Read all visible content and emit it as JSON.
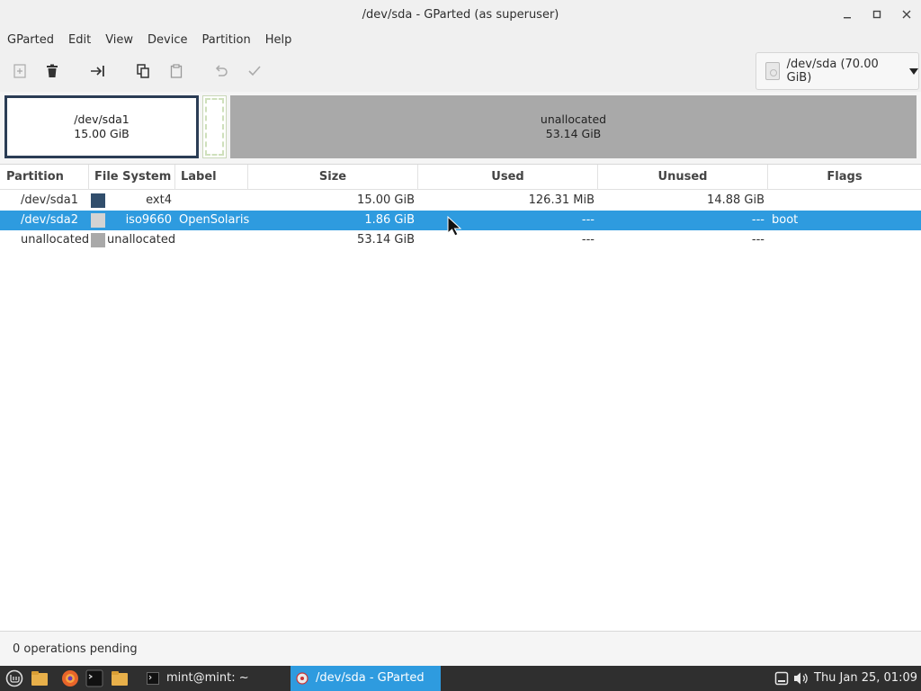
{
  "window": {
    "title": "/dev/sda - GParted (as superuser)"
  },
  "menu": [
    "GParted",
    "Edit",
    "View",
    "Device",
    "Partition",
    "Help"
  ],
  "toolbar": {
    "device_selector": "/dev/sda (70.00 GiB)"
  },
  "partition_map": {
    "sda1": {
      "name": "/dev/sda1",
      "size": "15.00 GiB"
    },
    "unallocated": {
      "name": "unallocated",
      "size": "53.14 GiB"
    }
  },
  "table": {
    "headers": [
      "Partition",
      "File System",
      "Label",
      "Size",
      "Used",
      "Unused",
      "Flags"
    ],
    "rows": [
      {
        "partition": "/dev/sda1",
        "fs": "ext4",
        "fs_color": "#314e6c",
        "label": "",
        "size": "15.00 GiB",
        "used": "126.31 MiB",
        "unused": "14.88 GiB",
        "flags": ""
      },
      {
        "partition": "/dev/sda2",
        "fs": "iso9660",
        "fs_color": "#d3d3d3",
        "label": "OpenSolaris",
        "size": "1.86 GiB",
        "used": "---",
        "unused": "---",
        "flags": "boot"
      },
      {
        "partition": "unallocated",
        "fs": "unallocated",
        "fs_color": "#a9a9a9",
        "label": "",
        "size": "53.14 GiB",
        "used": "---",
        "unused": "---",
        "flags": ""
      }
    ],
    "selected_row": 1
  },
  "status": "0 operations pending",
  "taskbar": {
    "windows": [
      "mint@mint: ~",
      "/dev/sda - GParted (..."
    ],
    "clock": "Thu Jan 25, 01:09"
  },
  "colors": {
    "selection": "#2e9bdf",
    "ext4": "#314e6c",
    "unallocated": "#a9a9a9",
    "taskbar": "#2f2f2f"
  }
}
